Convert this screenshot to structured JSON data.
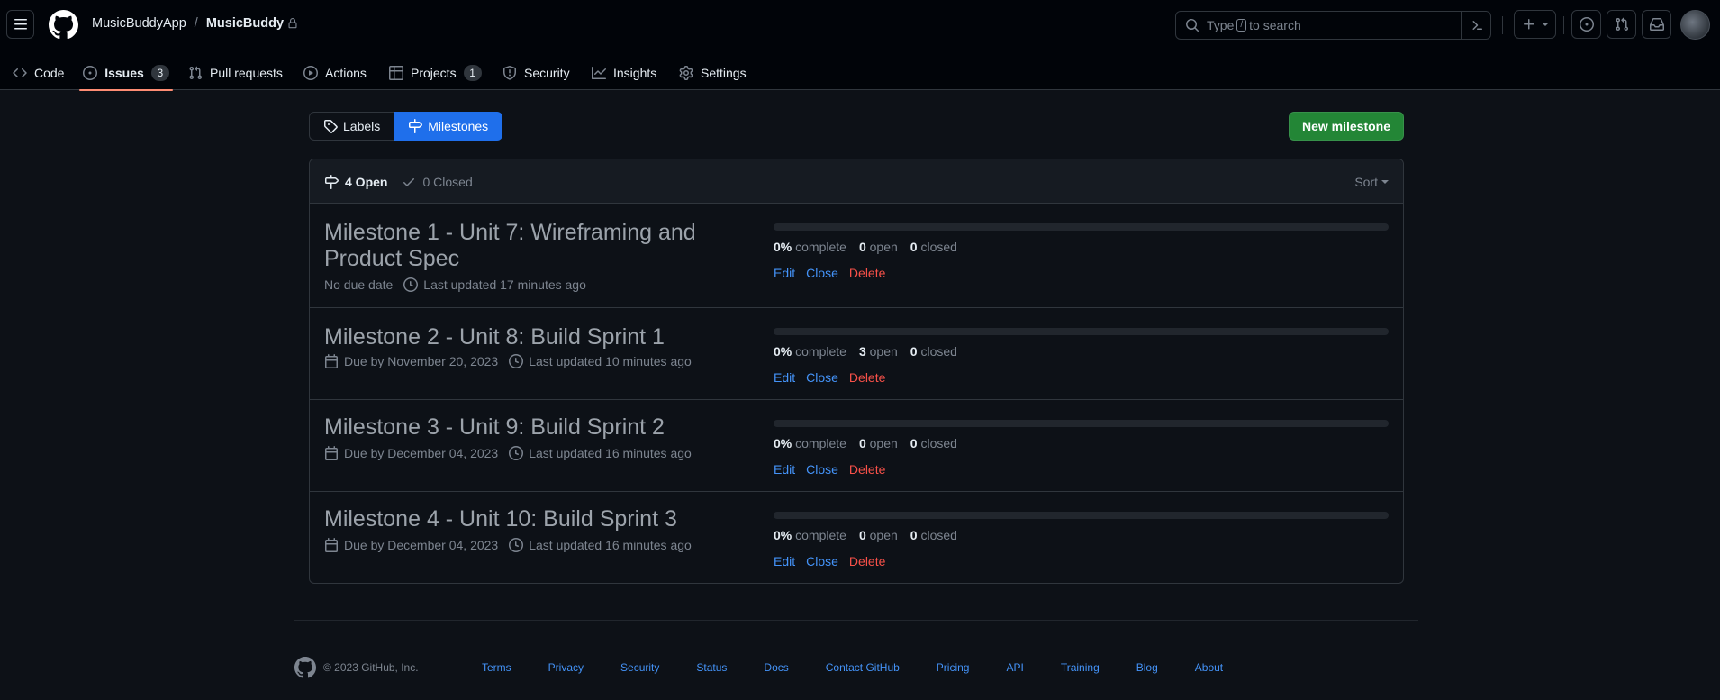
{
  "header": {
    "owner": "MusicBuddyApp",
    "separator": "/",
    "repo": "MusicBuddy",
    "search": {
      "before": "Type",
      "key": "/",
      "after": "to search"
    }
  },
  "repo_nav": [
    {
      "id": "code",
      "label": "Code",
      "icon": "code-icon"
    },
    {
      "id": "issues",
      "label": "Issues",
      "icon": "issue-opened-icon",
      "count": "3",
      "active": true
    },
    {
      "id": "pull-requests",
      "label": "Pull requests",
      "icon": "git-pull-request-icon"
    },
    {
      "id": "actions",
      "label": "Actions",
      "icon": "play-icon"
    },
    {
      "id": "projects",
      "label": "Projects",
      "icon": "table-icon",
      "count": "1"
    },
    {
      "id": "security",
      "label": "Security",
      "icon": "shield-icon"
    },
    {
      "id": "insights",
      "label": "Insights",
      "icon": "graph-icon"
    },
    {
      "id": "settings",
      "label": "Settings",
      "icon": "gear-icon"
    }
  ],
  "subnav": {
    "labels": "Labels",
    "milestones": "Milestones"
  },
  "new_milestone": "New milestone",
  "list_header": {
    "open": "4 Open",
    "closed": "0 Closed",
    "sort": "Sort"
  },
  "milestones": [
    {
      "title": "Milestone 1 - Unit 7: Wireframing and Product Spec",
      "due": "No due date",
      "updated": "Last updated 17 minutes ago",
      "percent": "0%",
      "percent_value": 0,
      "complete_label": "complete",
      "open": "0",
      "open_label": "open",
      "closed": "0",
      "closed_label": "closed",
      "edit": "Edit",
      "close": "Close",
      "delete": "Delete"
    },
    {
      "title": "Milestone 2 - Unit 8: Build Sprint 1",
      "due": "Due by November 20, 2023",
      "updated": "Last updated 10 minutes ago",
      "percent": "0%",
      "percent_value": 0,
      "complete_label": "complete",
      "open": "3",
      "open_label": "open",
      "closed": "0",
      "closed_label": "closed",
      "edit": "Edit",
      "close": "Close",
      "delete": "Delete"
    },
    {
      "title": "Milestone 3 - Unit 9: Build Sprint 2",
      "due": "Due by December 04, 2023",
      "updated": "Last updated 16 minutes ago",
      "percent": "0%",
      "percent_value": 0,
      "complete_label": "complete",
      "open": "0",
      "open_label": "open",
      "closed": "0",
      "closed_label": "closed",
      "edit": "Edit",
      "close": "Close",
      "delete": "Delete"
    },
    {
      "title": "Milestone 4 - Unit 10: Build Sprint 3",
      "due": "Due by December 04, 2023",
      "updated": "Last updated 16 minutes ago",
      "percent": "0%",
      "percent_value": 0,
      "complete_label": "complete",
      "open": "0",
      "open_label": "open",
      "closed": "0",
      "closed_label": "closed",
      "edit": "Edit",
      "close": "Close",
      "delete": "Delete"
    }
  ],
  "footer": {
    "copyright": "© 2023 GitHub, Inc.",
    "links": [
      "Terms",
      "Privacy",
      "Security",
      "Status",
      "Docs",
      "Contact GitHub",
      "Pricing",
      "API",
      "Training",
      "Blog",
      "About"
    ]
  },
  "colors": {
    "background": "#0d1117",
    "header_background": "#010409",
    "accent_blue": "#1f6feb",
    "link_blue": "#4493f8",
    "primary_green": "#238636",
    "danger_red": "#f85149",
    "active_tab_underline": "#fd8c73"
  }
}
